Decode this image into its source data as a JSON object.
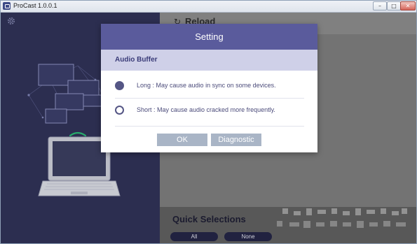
{
  "window": {
    "title": "ProCast 1.0.0.1",
    "controls": {
      "minimize": "–",
      "maximize": "□",
      "close": "✕"
    }
  },
  "sidebar": {
    "settings_icon": "gear-icon"
  },
  "main": {
    "reload_label": "Reload",
    "reload_icon": "↻",
    "quick_selections": {
      "title": "Quick Selections",
      "all_label": "All",
      "none_label": "None"
    }
  },
  "dialog": {
    "title": "Setting",
    "section_label": "Audio Buffer",
    "options": [
      {
        "label": "Long : May cause audio in sync on some devices.",
        "selected": true
      },
      {
        "label": "Short : May cause audio cracked more frequently.",
        "selected": false
      }
    ],
    "ok_label": "OK",
    "diagnostic_label": "Diagnostic"
  },
  "colors": {
    "sidebar_bg": "#2f3156",
    "dialog_header": "#5a5b9c",
    "section_bg": "#cfd0e8",
    "button_bg": "#a9b5c6",
    "wifi_green": "#2bb673"
  }
}
